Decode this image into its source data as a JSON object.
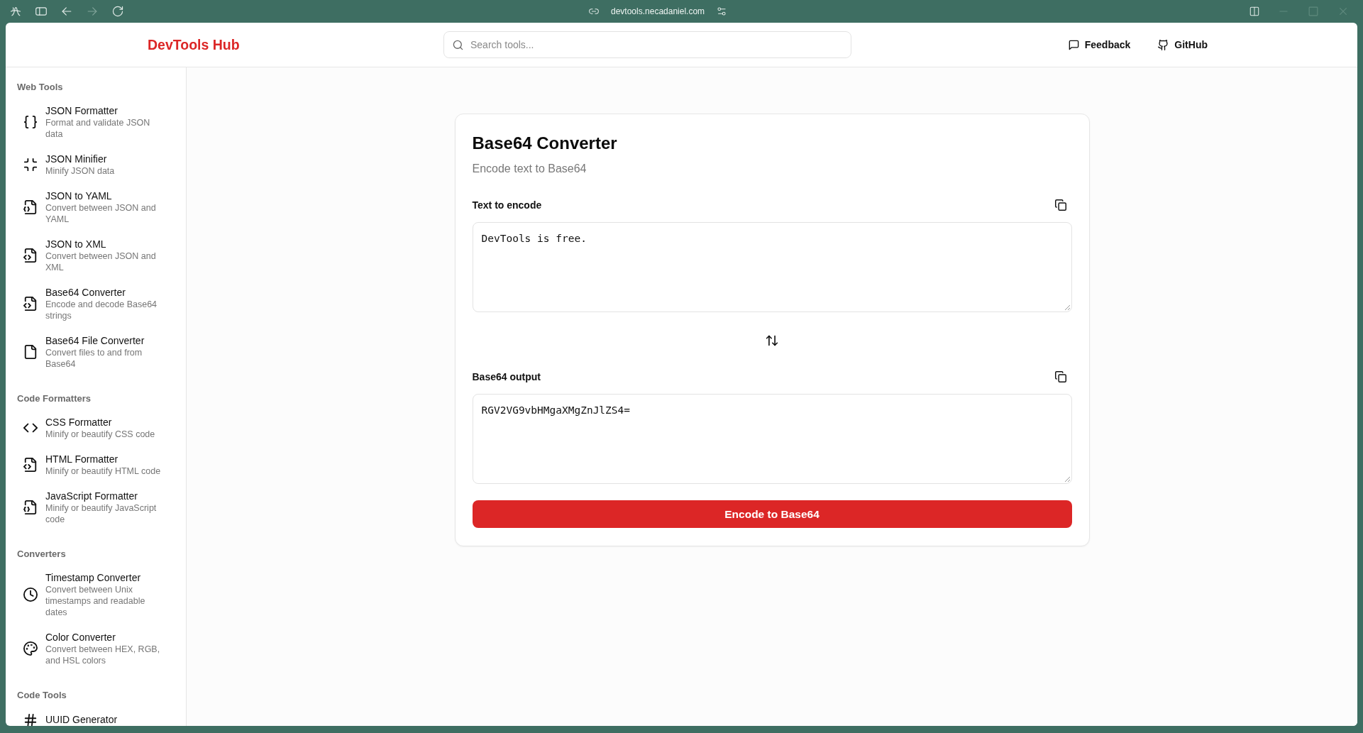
{
  "browser": {
    "url": "devtools.necadaniel.com"
  },
  "header": {
    "logo": "DevTools Hub",
    "search": {
      "placeholder": "Search tools..."
    },
    "links": [
      {
        "kind": "feedback",
        "label": "Feedback"
      },
      {
        "kind": "github",
        "label": "GitHub"
      }
    ]
  },
  "sidebar": {
    "sections": [
      {
        "title": "Web Tools",
        "items": [
          {
            "kind": "braces",
            "name": "JSON Formatter",
            "description": "Format and validate JSON data",
            "selected": false
          },
          {
            "kind": "minimize",
            "name": "JSON Minifier",
            "description": "Minify JSON data",
            "selected": false
          },
          {
            "kind": "filebraces",
            "name": "JSON to YAML",
            "description": "Convert between JSON and YAML",
            "selected": false
          },
          {
            "kind": "filecode",
            "name": "JSON to XML",
            "description": "Convert between JSON and XML",
            "selected": false
          },
          {
            "kind": "filecode",
            "name": "Base64 Converter",
            "description": "Encode and decode Base64 strings",
            "selected": false
          },
          {
            "kind": "file",
            "name": "Base64 File Converter",
            "description": "Convert files to and from Base64",
            "selected": false
          }
        ]
      },
      {
        "title": "Code Formatters",
        "items": [
          {
            "kind": "code",
            "name": "CSS Formatter",
            "description": "Minify or beautify CSS code",
            "selected": false
          },
          {
            "kind": "filecode",
            "name": "HTML Formatter",
            "description": "Minify or beautify HTML code",
            "selected": false
          },
          {
            "kind": "filebraces",
            "name": "JavaScript Formatter",
            "description": "Minify or beautify JavaScript code",
            "selected": false
          }
        ]
      },
      {
        "title": "Converters",
        "items": [
          {
            "kind": "clock",
            "name": "Timestamp Converter",
            "description": "Convert between Unix timestamps and readable dates",
            "selected": false
          },
          {
            "kind": "palette",
            "name": "Color Converter",
            "description": "Convert between HEX, RGB, and HSL colors",
            "selected": false
          }
        ]
      },
      {
        "title": "Code Tools",
        "items": [
          {
            "kind": "hash",
            "name": "UUID Generator",
            "selected": false
          }
        ]
      }
    ]
  },
  "tool": {
    "title": "Base64 Converter",
    "subtitle": "Encode text to Base64",
    "input": {
      "label": "Text to encode",
      "value": "DevTools is free."
    },
    "output": {
      "label": "Base64 output",
      "value": "RGV2VG9vbHMgaXMgZnJlZS4="
    },
    "action": "Encode to Base64"
  }
}
